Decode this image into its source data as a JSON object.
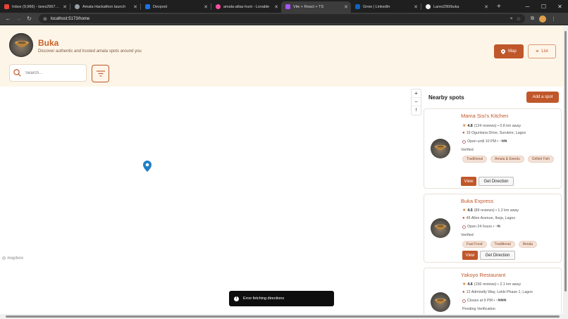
{
  "browser": {
    "tabs": [
      {
        "label": "Inbox (9,966) - lares2967@gm...",
        "icon": "gmail-icon",
        "color": "#ea4335"
      },
      {
        "label": "Amala Hackathon launch",
        "icon": "globe-icon",
        "color": "#9aa0a6"
      },
      {
        "label": "Devpost",
        "icon": "devpost-icon",
        "color": "#1a73e8"
      },
      {
        "label": "amala-atlas-hunt - Lovable",
        "icon": "lovable-icon",
        "color": "#ff4fa3"
      },
      {
        "label": "Vite + React + TS",
        "icon": "vite-icon",
        "color": "#a855f7",
        "active": true
      },
      {
        "label": "Grow | LinkedIn",
        "icon": "linkedin-icon",
        "color": "#0a66c2"
      },
      {
        "label": "Lares290/buka",
        "icon": "github-icon",
        "color": "#f0f0f0"
      }
    ],
    "new_tab": "+",
    "url": "localhost:5173/home"
  },
  "header": {
    "brand": "Buka",
    "tagline": "Discover authentic and trusted amala spots around you",
    "map_label": "Map",
    "list_label": "List",
    "search_placeholder": "Search..."
  },
  "map": {
    "attribution": "mapbox",
    "zoom_in": "+",
    "zoom_out": "−"
  },
  "sidebar": {
    "title": "Nearby spots",
    "add_spot": "Add a spot",
    "spots": [
      {
        "name": "Mama Sisi's Kitchen",
        "rating": "4.8",
        "reviews": "(124 reviews) • 0.8 km away",
        "address": "15 Ogunlana Drive, Surulere, Lagos",
        "hours": "Open until 10 PM • ~₦₦",
        "status": "Verified",
        "tags": [
          "Traditional",
          "Amala & Ewedu",
          "Grilled Fish"
        ],
        "view": "View",
        "directions": "Get Direction"
      },
      {
        "name": "Buka Express",
        "rating": "4.5",
        "reviews": "(89 reviews) • 1.2 km away",
        "address": "45 Allen Avenue, Ikeja, Lagos",
        "hours": "Open 24 hours • ~₦",
        "status": "Verified",
        "tags": [
          "Fast Food",
          "Traditional",
          "Amala"
        ],
        "view": "View",
        "directions": "Get Direction"
      },
      {
        "name": "Yakoyo Restaurant",
        "rating": "4.6",
        "reviews": "(156 reviews) • 2.1 km away",
        "address": "12 Admiralty Way, Lekki Phase 1, Lagos",
        "hours": "Closes at 9 PM • ~₦₦₦",
        "status": "Pending Verification"
      }
    ]
  },
  "toast": {
    "message": "Error fetching directions"
  },
  "colors": {
    "accent": "#c0572a",
    "header_bg": "#fdf5e8",
    "verified": "#2e9a4a",
    "pending": "#c7862a"
  }
}
